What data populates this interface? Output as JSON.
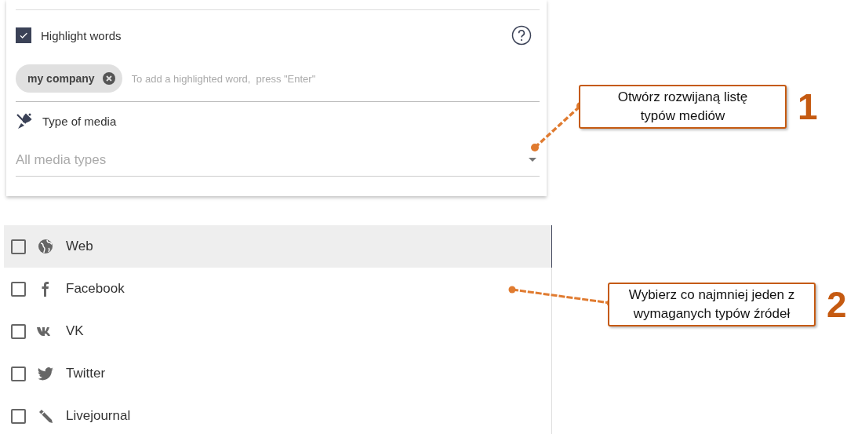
{
  "highlight": {
    "label": "Highlight words",
    "checked": true
  },
  "tags": [
    {
      "label": "my company"
    }
  ],
  "tag_input": {
    "placeholder": "To add a highlighted word,  press \"Enter\""
  },
  "media": {
    "label": "Type of media",
    "select": {
      "placeholder": "All media types"
    }
  },
  "media_options": [
    {
      "kind": "web",
      "label": "Web",
      "checked": false,
      "selected": true
    },
    {
      "kind": "facebook",
      "label": "Facebook",
      "checked": false,
      "selected": false
    },
    {
      "kind": "vk",
      "label": "VK",
      "checked": false,
      "selected": false
    },
    {
      "kind": "twitter",
      "label": "Twitter",
      "checked": false,
      "selected": false
    },
    {
      "kind": "livejournal",
      "label": "Livejournal",
      "checked": false,
      "selected": false
    }
  ],
  "callouts": [
    {
      "number": "1",
      "lines": [
        "Otwórz rozwijaną listę",
        "typów mediów"
      ]
    },
    {
      "number": "2",
      "lines": [
        "Wybierz co najmniej jeden z",
        "wymaganych typów źródeł"
      ]
    }
  ]
}
